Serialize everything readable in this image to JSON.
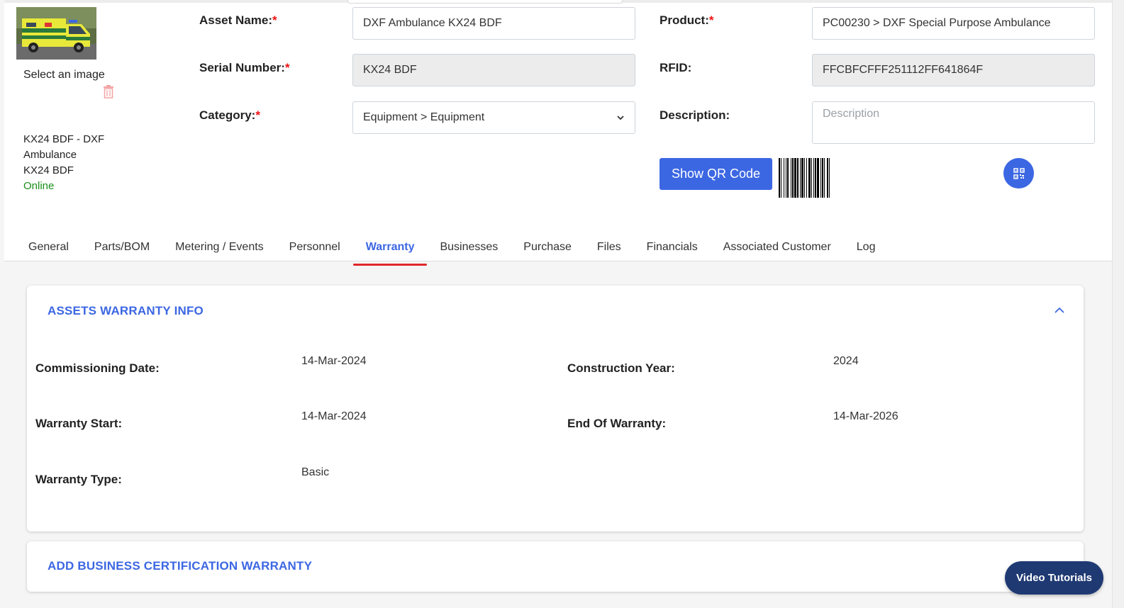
{
  "asset_sidebar": {
    "select_image_label": "Select an image",
    "summary_line1": "KX24 BDF - DXF",
    "summary_line2": "Ambulance",
    "summary_line3": "KX24 BDF",
    "status": "Online",
    "status_color": "#1a8f1a"
  },
  "form": {
    "asset_name": {
      "label": "Asset Name:",
      "required_mark": "*",
      "value": "DXF Ambulance KX24 BDF"
    },
    "serial_number": {
      "label": "Serial Number:",
      "required_mark": "*",
      "value": "KX24 BDF"
    },
    "category": {
      "label": "Category:",
      "required_mark": "*",
      "value": "Equipment > Equipment"
    },
    "product": {
      "label": "Product:",
      "required_mark": "*",
      "value": "PC00230 > DXF Special Purpose Ambulance"
    },
    "rfid": {
      "label": "RFID:",
      "value": "FFCBFCFFF251112FF641864F"
    },
    "description": {
      "label": "Description:",
      "placeholder": "Description"
    },
    "show_qr_label": "Show QR Code"
  },
  "tabs": [
    {
      "label": "General"
    },
    {
      "label": "Parts/BOM"
    },
    {
      "label": "Metering / Events"
    },
    {
      "label": "Personnel"
    },
    {
      "label": "Warranty",
      "active": true
    },
    {
      "label": "Businesses"
    },
    {
      "label": "Purchase"
    },
    {
      "label": "Files"
    },
    {
      "label": "Financials"
    },
    {
      "label": "Associated Customer"
    },
    {
      "label": "Log"
    }
  ],
  "warranty_card": {
    "title": "ASSETS WARRANTY INFO",
    "commissioning_date": {
      "label": "Commissioning Date:",
      "value": "14-Mar-2024"
    },
    "construction_year": {
      "label": "Construction Year:",
      "value": "2024"
    },
    "warranty_start": {
      "label": "Warranty Start:",
      "value": "14-Mar-2024"
    },
    "end_of_warranty": {
      "label": "End Of Warranty:",
      "value": "14-Mar-2026"
    },
    "warranty_type": {
      "label": "Warranty Type:",
      "value": "Basic"
    }
  },
  "cert_card": {
    "title": "ADD BUSINESS CERTIFICATION WARRANTY"
  },
  "video_tutorials_label": "Video Tutorials",
  "colors": {
    "accent": "#3c67e3",
    "active_tab_underline": "#e0272b",
    "required": "#e11111",
    "video_button": "#1f3a73"
  }
}
